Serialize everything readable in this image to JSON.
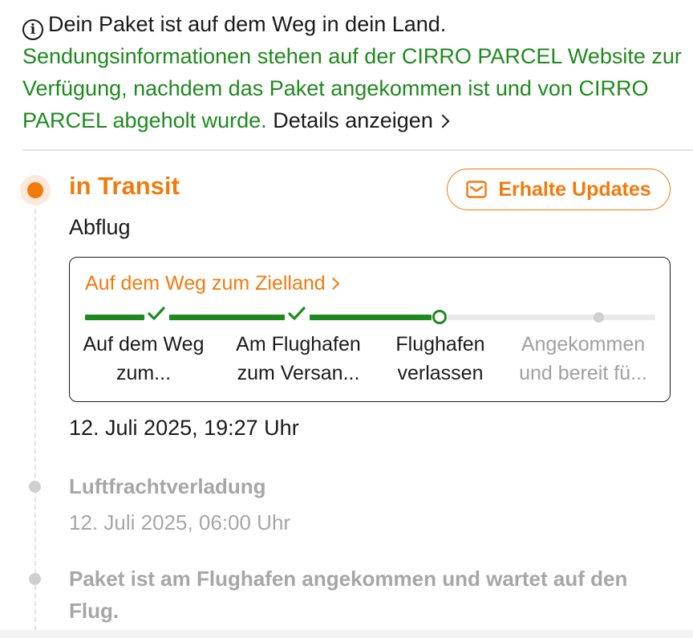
{
  "notice": {
    "icon": "info-icon",
    "headline": "Dein Paket ist auf dem Weg in dein Land.",
    "green_text": "Sendungsinformationen stehen auf der CIRRO PARCEL Website zur Verfügung, nachdem das Paket angekommen ist und von CIRRO PARCEL abgeholt wurde.",
    "details_link": "Details anzeigen"
  },
  "current_status": {
    "title": "in Transit",
    "subtitle": "Abflug",
    "updates_button": "Erhalte Updates",
    "updates_icon": "mail-icon",
    "card": {
      "link": "Auf dem Weg zum Zielland",
      "progress_steps_completed": 3,
      "steps": [
        {
          "line1": "Auf dem Weg",
          "line2": "zum...",
          "state": "done"
        },
        {
          "line1": "Am Flughafen",
          "line2": "zum Versan...",
          "state": "done"
        },
        {
          "line1": "Flughafen",
          "line2": "verlassen",
          "state": "current"
        },
        {
          "line1": "Angekommen",
          "line2": "und bereit fü...",
          "state": "pending"
        }
      ]
    },
    "timestamp": "12. Juli 2025, 19:27 Uhr"
  },
  "events": [
    {
      "title": "Luftfrachtverladung",
      "time": "12. Juli 2025, 06:00 Uhr"
    },
    {
      "title": "Paket ist am Flughafen angekommen und wartet auf den Flug.",
      "time": ""
    }
  ],
  "colors": {
    "accent": "#f27a0c",
    "success": "#1e8a1e",
    "muted": "#a6a6a6"
  }
}
